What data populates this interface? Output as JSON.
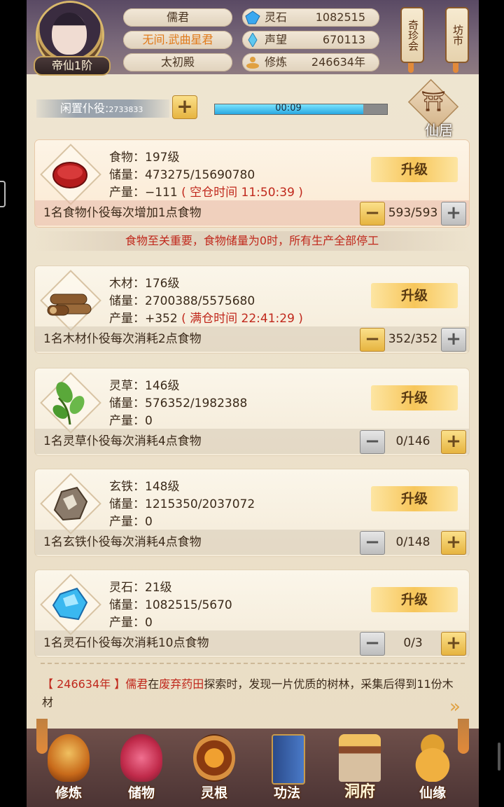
{
  "header": {
    "rank_badge": "帝仙1阶",
    "names": [
      "儒君",
      "无间.武曲星君",
      "太初殿"
    ],
    "stats": [
      {
        "label": "灵石",
        "value": "1082515",
        "icon": "spirit-stone-icon"
      },
      {
        "label": "声望",
        "value": "670113",
        "icon": "reputation-icon"
      },
      {
        "label": "修炼",
        "value": "246634年",
        "icon": "cultivation-icon"
      }
    ],
    "hang_buttons": [
      "奇珍会",
      "坊市"
    ]
  },
  "idle": {
    "label": "闲置仆役:",
    "count": "2733833",
    "plus": "+",
    "timer": "00:09",
    "progress": 0.86,
    "residence_label": "仙居"
  },
  "resources": [
    {
      "key": "food",
      "name_line": "食物：197级",
      "storage_line": "储量：473275/15690780",
      "output_prefix": "产量：−111",
      "output_note": "( 空仓时间 11:50:39 )",
      "upgrade": "升级",
      "desc": "1名食物仆役每次增加1点食物",
      "count": "593/593",
      "minus": "−",
      "plus": "+"
    },
    {
      "key": "wood",
      "name_line": "木材：176级",
      "storage_line": "储量：2700388/5575680",
      "output_prefix": "产量：+352",
      "output_note": "( 满仓时间 22:41:29 )",
      "upgrade": "升级",
      "desc": "1名木材仆役每次消耗2点食物",
      "count": "352/352",
      "minus": "−",
      "plus": "+"
    },
    {
      "key": "herb",
      "name_line": "灵草：146级",
      "storage_line": "储量：576352/1982388",
      "output_prefix": "产量：0",
      "output_note": "",
      "upgrade": "升级",
      "desc": "1名灵草仆役每次消耗4点食物",
      "count": "0/146",
      "minus": "−",
      "plus": "+"
    },
    {
      "key": "iron",
      "name_line": "玄铁：148级",
      "storage_line": "储量：1215350/2037072",
      "output_prefix": "产量：0",
      "output_note": "",
      "upgrade": "升级",
      "desc": "1名玄铁仆役每次消耗4点食物",
      "count": "0/148",
      "minus": "−",
      "plus": "+"
    },
    {
      "key": "stone",
      "name_line": "灵石：21级",
      "storage_line": "储量：1082515/5670",
      "output_prefix": "产量：0",
      "output_note": "",
      "upgrade": "升级",
      "desc": "1名灵石仆役每次消耗10点食物",
      "count": "0/3",
      "minus": "−",
      "plus": "+"
    }
  ],
  "notice": "食物至关重要，食物储量为0时，所有生产全部停工",
  "log": {
    "year": "【 246634年 】",
    "actor": "儒君",
    "text1": "在",
    "place": "废弃药田",
    "text2": "探索时，发现一片优质的树林，采集后得到11份木材"
  },
  "nav": [
    "修炼",
    "储物",
    "灵根",
    "功法",
    "洞府",
    "仙缘"
  ],
  "colors": {
    "accent_red": "#c0281c",
    "gold": "#f7c65a",
    "orange": "#e07a1a"
  }
}
